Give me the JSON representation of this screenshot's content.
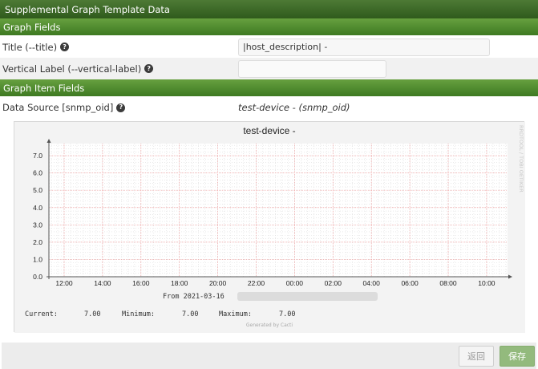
{
  "header": {
    "title": "Supplemental Graph Template Data"
  },
  "sections": {
    "graph_fields": "Graph Fields",
    "graph_item_fields": "Graph Item Fields"
  },
  "fields": {
    "title": {
      "label": "Title (--title)",
      "value": "|host_description| -"
    },
    "vertical_label": {
      "label": "Vertical Label (--vertical-label)",
      "value": ""
    },
    "data_source": {
      "label": "Data Source [snmp_oid]",
      "value": "test-device - (snmp_oid)"
    }
  },
  "graph": {
    "title": "test-device -",
    "side_watermark": "RRDTOOL / TOBI OETIKER",
    "from_text": "From 2021-03-16",
    "stats": {
      "current_label": "Current:",
      "current_value": "7.00",
      "minimum_label": "Minimum:",
      "minimum_value": "7.00",
      "maximum_label": "Maximum:",
      "maximum_value": "7.00"
    },
    "generated_by": "Generated by Cacti"
  },
  "chart_data": {
    "type": "line",
    "title": "test-device -",
    "xlabel": "",
    "ylabel": "",
    "x_tick_labels": [
      "12:00",
      "14:00",
      "16:00",
      "18:00",
      "20:00",
      "22:00",
      "00:00",
      "02:00",
      "04:00",
      "06:00",
      "08:00",
      "10:00"
    ],
    "y_tick_labels": [
      "0.0",
      "1.0",
      "2.0",
      "3.0",
      "4.0",
      "5.0",
      "6.0",
      "7.0"
    ],
    "ylim": [
      0,
      7.7
    ],
    "grid": true,
    "series": []
  },
  "footer": {
    "return_label": "返回",
    "save_label": "保存"
  },
  "colors": {
    "header_bg": "#2f5a1c",
    "section_bg": "#4e8a2c",
    "grid_major": "#f2a3a3",
    "grid_minor": "#d9d9d9",
    "save_button": "#93ba7d"
  }
}
